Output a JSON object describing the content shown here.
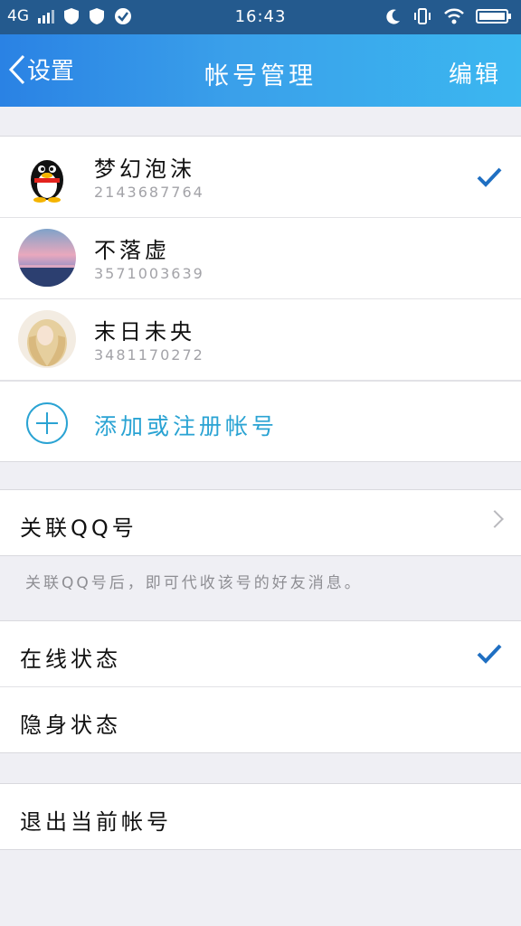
{
  "status_bar": {
    "network": "4G",
    "time": "16:43"
  },
  "nav": {
    "back_label": "设置",
    "title": "帐号管理",
    "edit_label": "编辑"
  },
  "accounts": [
    {
      "name": "梦幻泡沫",
      "number": "2143687764",
      "selected": true
    },
    {
      "name": "不落虚",
      "number": "3571003639",
      "selected": false
    },
    {
      "name": "末日未央",
      "number": "3481170272",
      "selected": false
    }
  ],
  "add_account_label": "添加或注册帐号",
  "link_qq": {
    "label": "关联QQ号",
    "note": "关联QQ号后，即可代收该号的好友消息。"
  },
  "status_options": [
    {
      "label": "在线状态",
      "selected": true
    },
    {
      "label": "隐身状态",
      "selected": false
    }
  ],
  "logout_label": "退出当前帐号",
  "colors": {
    "nav_gradient_start": "#2a82e4",
    "nav_gradient_end": "#3bb7f0",
    "accent": "#2aa3d3",
    "check": "#1f6fc2"
  }
}
